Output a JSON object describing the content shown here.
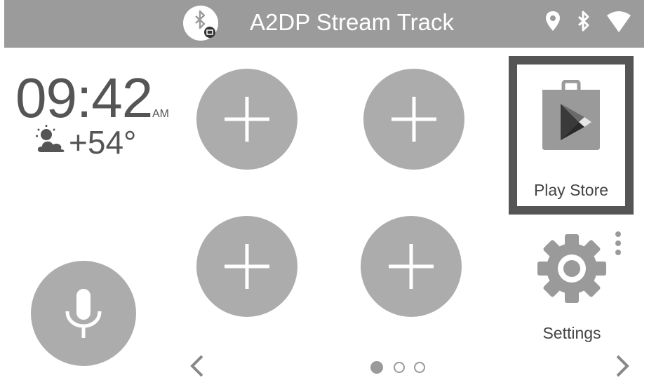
{
  "status_bar": {
    "track_title": "A2DP Stream Track",
    "left_icon": "bluetooth-stream-icon",
    "right_icons": [
      "location-pin-icon",
      "bluetooth-icon",
      "wifi-icon"
    ],
    "background_color": "#9b9b9b"
  },
  "clock_widget": {
    "time": "09:42",
    "ampm": "AM",
    "weather_icon": "partly-cloudy-icon",
    "temperature": "+54°"
  },
  "shortcuts": {
    "add_slots": [
      "add-shortcut-icon",
      "add-shortcut-icon",
      "add-shortcut-icon",
      "add-shortcut-icon"
    ],
    "voice_button_icon": "microphone-icon"
  },
  "apps": {
    "play_store": {
      "label": "Play Store",
      "icon": "play-store-icon",
      "selected": true
    },
    "settings": {
      "label": "Settings",
      "icon": "gear-icon"
    }
  },
  "pager": {
    "page_count": 3,
    "current_page": 1,
    "prev_icon": "chevron-left-icon",
    "next_icon": "chevron-right-icon"
  },
  "colors": {
    "button_fill": "#acacac",
    "selection_border": "#555555"
  }
}
